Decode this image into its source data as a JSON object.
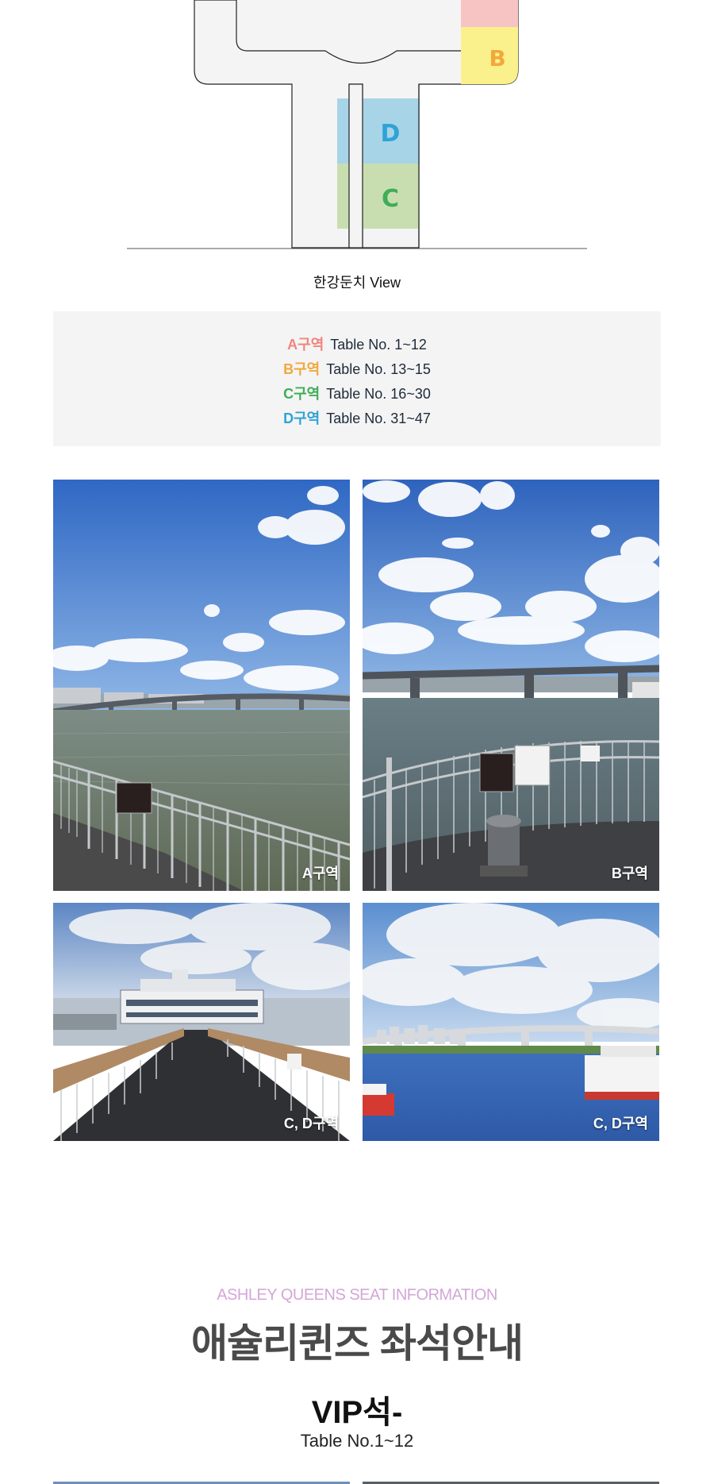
{
  "map": {
    "zones": [
      {
        "letter": "B",
        "color": "#f2a83c"
      },
      {
        "letter": "D",
        "color": "#2fa3d6"
      },
      {
        "letter": "C",
        "color": "#3fae56"
      }
    ],
    "view_caption": "한강둔치 View"
  },
  "legend": [
    {
      "zone": "A구역",
      "range": "Table No. 1~12",
      "color": "#f2857d"
    },
    {
      "zone": "B구역",
      "range": "Table No. 13~15",
      "color": "#f2a83c"
    },
    {
      "zone": "C구역",
      "range": "Table No. 16~30",
      "color": "#3fae56"
    },
    {
      "zone": "D구역",
      "range": "Table No. 31~47",
      "color": "#2fa3d6"
    }
  ],
  "photos": [
    {
      "label": "A구역"
    },
    {
      "label": "B구역"
    },
    {
      "label": "C, D구역"
    },
    {
      "label": "C, D구역"
    }
  ],
  "section": {
    "subtitle": "ASHLEY QUEENS SEAT INFORMATION",
    "title": "애슐리퀸즈 좌석안내",
    "vip_title": "VIP석-",
    "vip_range": "Table No.1~12"
  }
}
